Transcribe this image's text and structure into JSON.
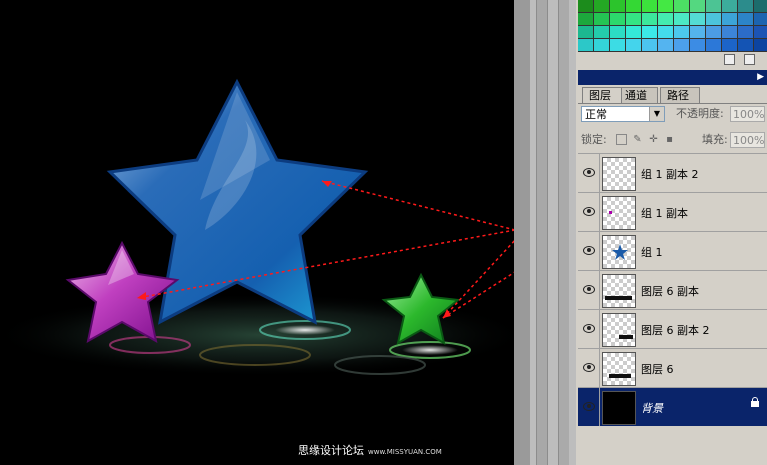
{
  "layers_panel": {
    "tabs": [
      {
        "label": "图层",
        "active": true
      },
      {
        "label": "通道",
        "active": false
      },
      {
        "label": "路径",
        "active": false
      }
    ],
    "blend_mode": "正常",
    "opacity_label": "不透明度:",
    "opacity_value": "100%",
    "lock_label": "锁定:",
    "fill_label": "填充:",
    "fill_value": "100%",
    "layers": [
      {
        "name": "组 1 副本 2",
        "visible": true,
        "selected": false
      },
      {
        "name": "组 1 副本",
        "visible": true,
        "selected": false
      },
      {
        "name": "组 1",
        "visible": true,
        "selected": false
      },
      {
        "name": "图层 6 副本",
        "visible": true,
        "selected": false
      },
      {
        "name": "图层 6 副本 2",
        "visible": true,
        "selected": false
      },
      {
        "name": "图层 6",
        "visible": true,
        "selected": false
      },
      {
        "name": "背景",
        "visible": true,
        "selected": true,
        "locked": true
      }
    ]
  },
  "swatches": {
    "colors": [
      "#1c8c1c",
      "#24a824",
      "#2cc42c",
      "#34d834",
      "#3ce23c",
      "#44e844",
      "#4ce064",
      "#54d880",
      "#4cc494",
      "#3cac9c",
      "#2c8c8c",
      "#1c6c6c",
      "#1ca83c",
      "#24c454",
      "#2cd86c",
      "#34e484",
      "#3ce89c",
      "#44ecb0",
      "#4ce8c4",
      "#54dcd4",
      "#4cc4dc",
      "#3ca4d8",
      "#2c84c8",
      "#1c64b0",
      "#1cb890",
      "#24ccac",
      "#2cdcc4",
      "#34e8d8",
      "#3ce8e8",
      "#44dcec",
      "#4cc8ec",
      "#54b4ec",
      "#4c9ce4",
      "#3c84d8",
      "#2c6cc8",
      "#1c54b4",
      "#2cc8c8",
      "#34d4d8",
      "#3cdce4",
      "#44d4ec",
      "#4cc4f0",
      "#54b4f0",
      "#4ca0ec",
      "#3c8ce4",
      "#2c78d8",
      "#1c64c8",
      "#1454b4",
      "#0c44a0"
    ]
  },
  "watermark": {
    "text": "思缘设计论坛",
    "url": "www.MISSYUAN.COM"
  },
  "colors": {
    "panel_bg": "#d4d0c8",
    "selection": "#0a246a",
    "arrow": "#ff1a1a"
  }
}
